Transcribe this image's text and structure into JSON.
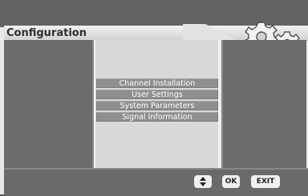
{
  "header": {
    "title": "Configuration"
  },
  "icons": {
    "gears": "gears-icon",
    "updown": "up-down-arrows-icon"
  },
  "menu": {
    "items": [
      {
        "label": "Channel Installation"
      },
      {
        "label": "User Settings"
      },
      {
        "label": "System Parameters"
      },
      {
        "label": "Signal Information"
      }
    ]
  },
  "footer": {
    "ok_label": "OK",
    "exit_label": "EXIT"
  },
  "colors": {
    "background": "#636363",
    "panel_dark": "#6c6c6c",
    "panel_center": "#d8d8d8",
    "menu_item": "#8f8f8f",
    "button": "#f0f0f0"
  }
}
